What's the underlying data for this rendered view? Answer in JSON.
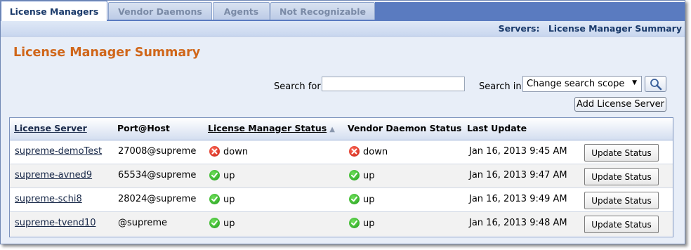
{
  "tabs": [
    {
      "label": "License Managers",
      "active": true
    },
    {
      "label": "Vendor Daemons",
      "active": false
    },
    {
      "label": "Agents",
      "active": false
    },
    {
      "label": "Not Recognizable",
      "active": false
    }
  ],
  "breadcrumb": {
    "section": "Servers:",
    "page": "License Manager Summary"
  },
  "page_title": "License Manager Summary",
  "search": {
    "for_label": "Search for",
    "value": "",
    "in_label": "Search in",
    "scope_selected": "Change search scope",
    "button_icon": "magnifier-icon"
  },
  "add_button_label": "Add License Server",
  "table": {
    "headers": {
      "server": "License Server",
      "port_host": "Port@Host",
      "lm_status": "License Manager Status",
      "vd_status": "Vendor Daemon Status",
      "last_update": "Last Update"
    },
    "rows": [
      {
        "server": "supreme-demoTest",
        "port_host": "27008@supreme",
        "lm_status": "down",
        "vd_status": "down",
        "last_update": "Jan 16, 2013 9:45 AM",
        "button": "Update Status"
      },
      {
        "server": "supreme-avned9",
        "port_host": "65534@supreme",
        "lm_status": "up",
        "vd_status": "up",
        "last_update": "Jan 16, 2013 9:47 AM",
        "button": "Update Status"
      },
      {
        "server": "supreme-schi8",
        "port_host": "28024@supreme",
        "lm_status": "up",
        "vd_status": "up",
        "last_update": "Jan 16, 2013 9:49 AM",
        "button": "Update Status"
      },
      {
        "server": "supreme-tvend10",
        "port_host": "@supreme",
        "lm_status": "up",
        "vd_status": "up",
        "last_update": "Jan 16, 2013 9:48 AM",
        "button": "Update Status"
      }
    ]
  },
  "colors": {
    "title": "#d0661a",
    "accent": "#5a7bc0",
    "down": "#c81f10",
    "up": "#1f9a18"
  }
}
